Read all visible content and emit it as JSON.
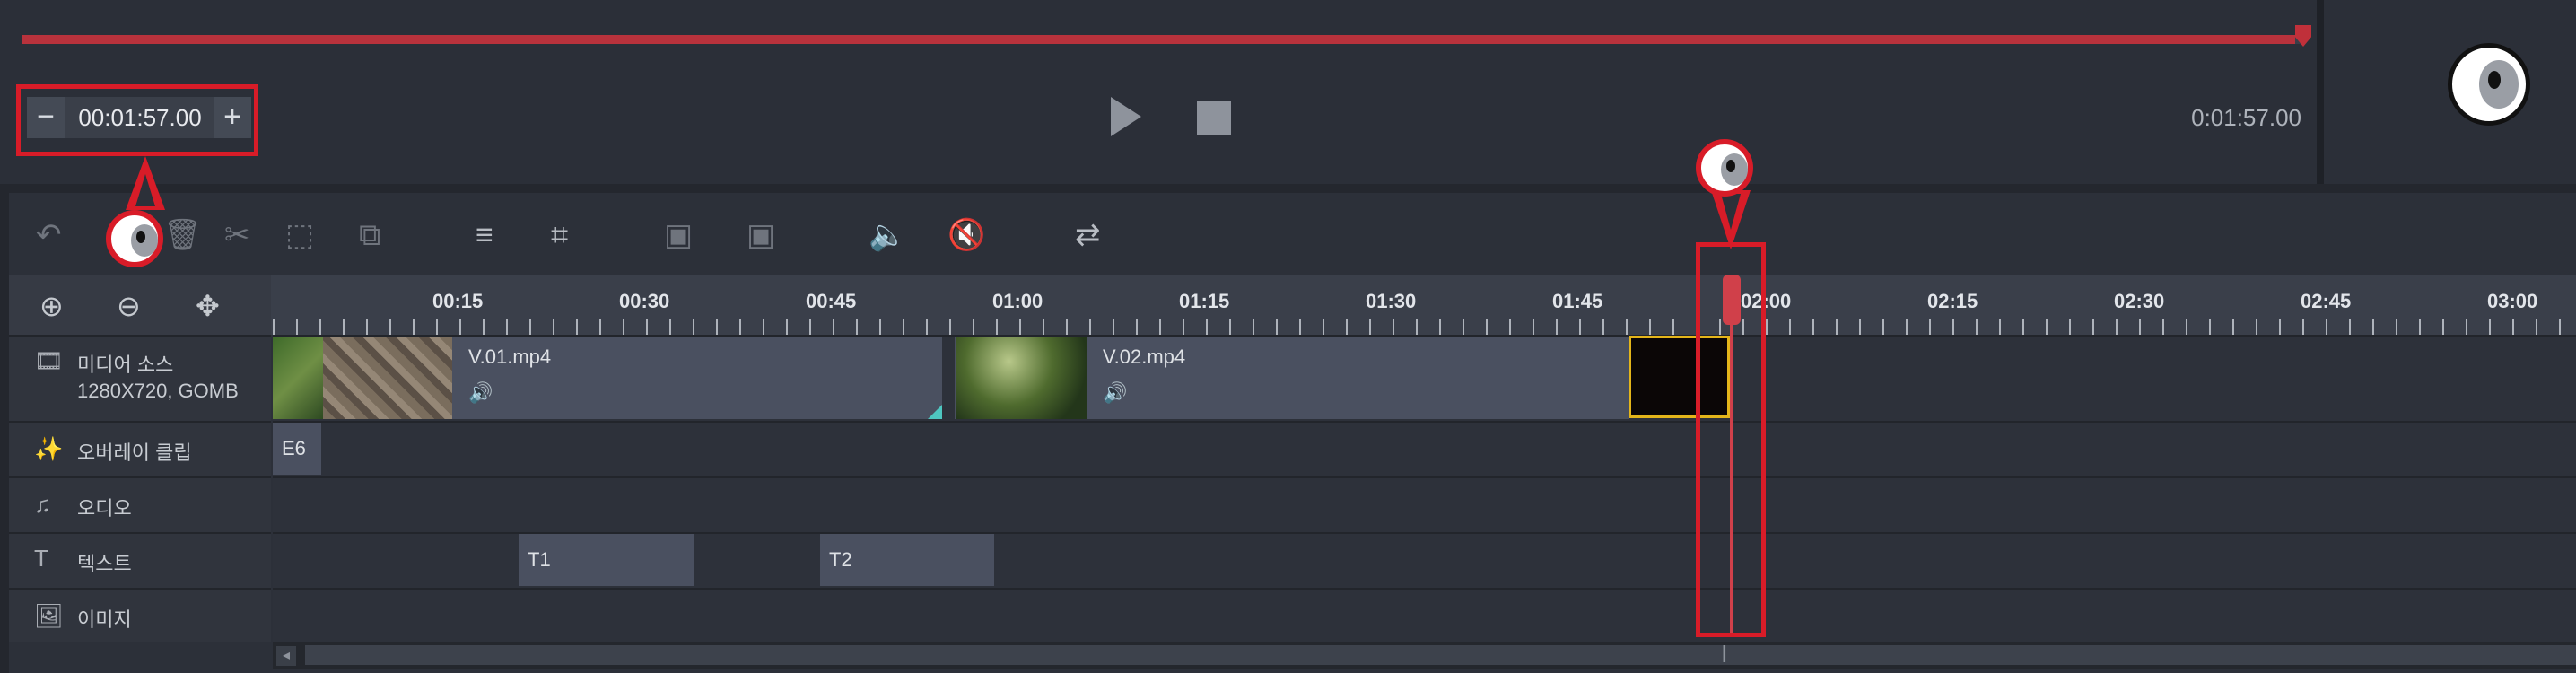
{
  "preview": {
    "progress": 0.996,
    "current_time": "00:01:57.00",
    "decrement_label": "−",
    "increment_label": "+",
    "time_readout": "0:01:57.00"
  },
  "toolbar": {
    "icons": [
      "undo-icon",
      "delete-icon",
      "cut-icon",
      "select-region-icon",
      "split-icon",
      "adjust-icon",
      "crop-icon",
      "image-in-icon",
      "image-out-icon",
      "audio-in-icon",
      "audio-mute-icon",
      "replace-image-icon"
    ]
  },
  "ruler": {
    "ticks": [
      "00:15",
      "00:30",
      "00:45",
      "01:00",
      "01:15",
      "01:30",
      "01:45",
      "02:00",
      "02:15",
      "02:30",
      "02:45",
      "03:00"
    ]
  },
  "tracks": [
    {
      "name": "미디어 소스",
      "subtitle": "1280X720, GOMB",
      "icon": "film-icon"
    },
    {
      "name": "오버레이 클립",
      "icon": "overlay-icon"
    },
    {
      "name": "오디오",
      "icon": "music-note-icon"
    },
    {
      "name": "텍스트",
      "icon": "text-icon"
    },
    {
      "name": "이미지",
      "icon": "image-icon"
    }
  ],
  "clips": {
    "video1": "V.01.mp4",
    "video2": "V.02.mp4",
    "overlay": "E6",
    "text1": "T1",
    "text2": "T2"
  },
  "colors": {
    "accent": "#d81c28",
    "progress": "#b8323c",
    "selection": "#e4b51a",
    "panel": "#2c3039"
  }
}
